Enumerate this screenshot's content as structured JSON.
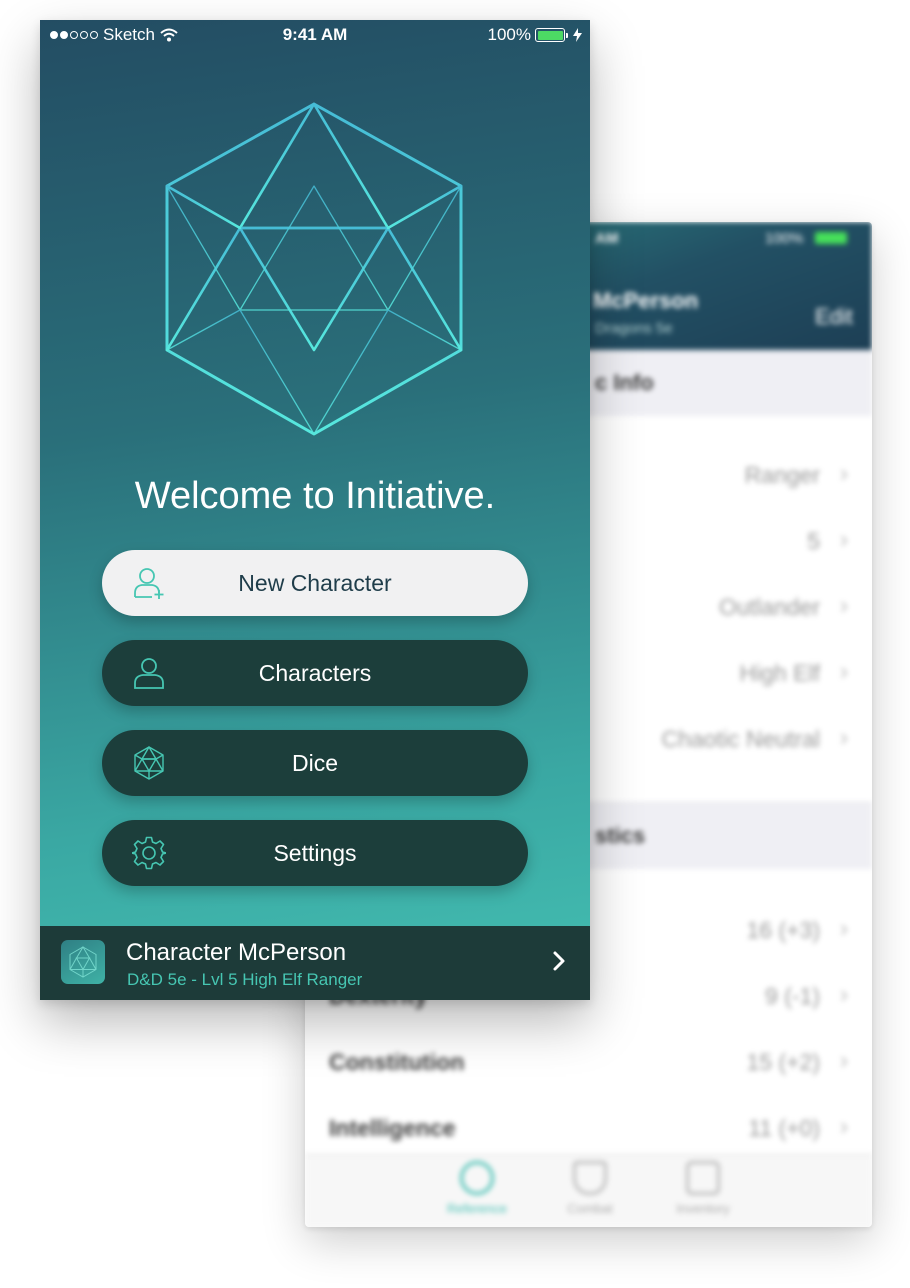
{
  "status_bar": {
    "carrier": "Sketch",
    "time": "9:41 AM",
    "battery": "100%"
  },
  "home": {
    "welcome": "Welcome to Initiative.",
    "buttons": [
      {
        "label": "New Character",
        "icon": "add-person-icon",
        "style": "light"
      },
      {
        "label": "Characters",
        "icon": "person-icon",
        "style": "dark"
      },
      {
        "label": "Dice",
        "icon": "d20-icon",
        "style": "dark"
      },
      {
        "label": "Settings",
        "icon": "gear-icon",
        "style": "dark"
      }
    ],
    "current_character": {
      "name": "Character McPerson",
      "description": "D&D 5e - Lvl 5 High Elf Ranger"
    }
  },
  "background_screen": {
    "status_time": "AM",
    "status_battery": "100%",
    "header_title": "McPerson",
    "header_subtitle": "Dragons 5e",
    "edit_label": "Edit",
    "section1": "c Info",
    "info_rows": [
      {
        "value": "Ranger"
      },
      {
        "value": "5"
      },
      {
        "value": "Outlander"
      },
      {
        "value": "High Elf"
      },
      {
        "value": "Chaotic Neutral"
      }
    ],
    "section2": "stics",
    "stat_rows": [
      {
        "label": "",
        "value": "16 (+3)"
      },
      {
        "label": "Dexterity",
        "value": "9 (-1)"
      },
      {
        "label": "Constitution",
        "value": "15 (+2)"
      },
      {
        "label": "Intelligence",
        "value": "11 (+0)"
      }
    ],
    "tabs": [
      {
        "label": "Reference",
        "active": true
      },
      {
        "label": "Combat",
        "active": false
      },
      {
        "label": "Inventory",
        "active": false
      }
    ]
  },
  "colors": {
    "accent": "#46c6b2",
    "dark_button": "#1c3e3b",
    "light_button": "#f1f1f2",
    "gradient_top": "#234d63",
    "gradient_bottom": "#44bfb2"
  }
}
